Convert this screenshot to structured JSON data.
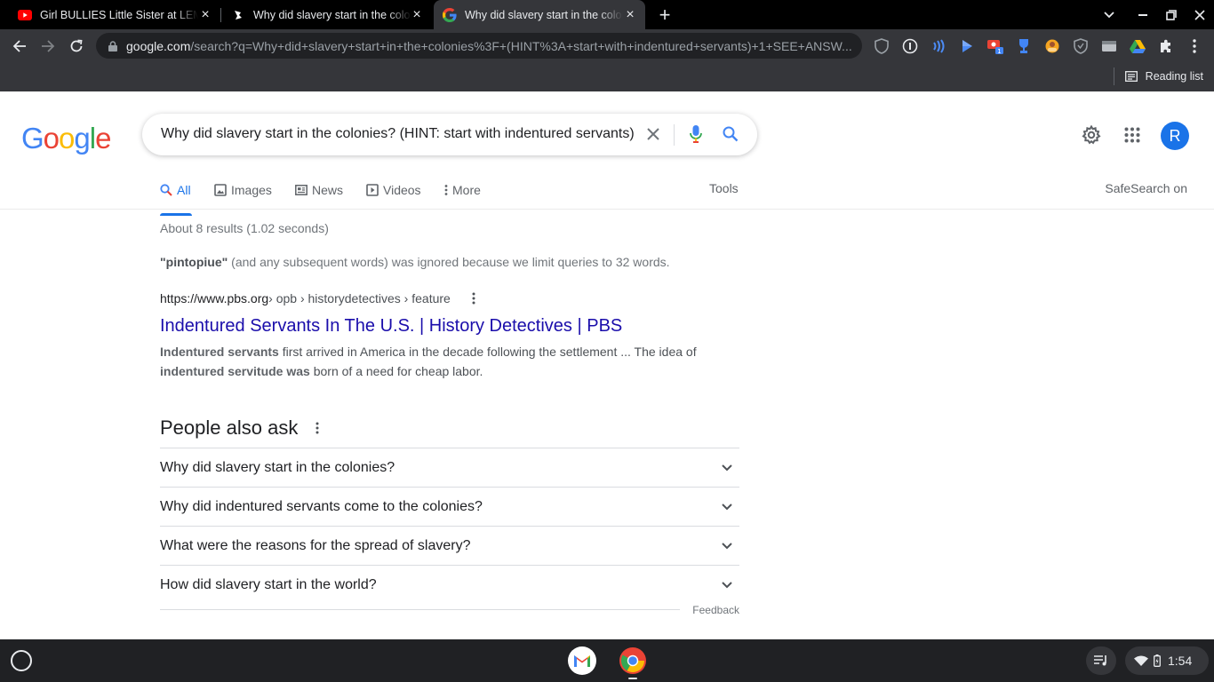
{
  "tabs": [
    {
      "title": "Girl BULLIES Little Sister at LEMONADE STAND",
      "active": false,
      "favicon": "youtube-icon"
    },
    {
      "title": "Why did slavery start in the colonies?",
      "active": false,
      "favicon": "brainly-icon"
    },
    {
      "title": "Why did slavery start in the colonies?",
      "active": true,
      "favicon": "google-icon"
    }
  ],
  "omnibox": {
    "host": "google.com",
    "path": "/search?q=Why+did+slavery+start+in+the+colonies%3F+(HINT%3A+start+with+indentured+servants)+1+SEE+ANSW..."
  },
  "bookmarks": {
    "reading_list": "Reading list"
  },
  "logo": [
    "G",
    "o",
    "o",
    "g",
    "l",
    "e"
  ],
  "colors": {
    "google_blue": "#4285F4",
    "google_red": "#EA4335",
    "google_yellow": "#FBBC05",
    "google_green": "#34A853",
    "link": "#1a0dab",
    "accent": "#1a73e8"
  },
  "search": {
    "query": "Why did slavery start in the colonies? (HINT: start with indentured servants)"
  },
  "user": {
    "initial": "R"
  },
  "nav": {
    "all": "All",
    "images": "Images",
    "news": "News",
    "videos": "Videos",
    "more": "More",
    "tools": "Tools",
    "safesearch": "SafeSearch on"
  },
  "stats": "About 8 results (1.02 seconds)",
  "ignored": {
    "word": "\"pintopiue\"",
    "rest": " (and any subsequent words) was ignored because we limit queries to 32 words."
  },
  "result": {
    "site": "https://www.pbs.org",
    "breadcrumbs": " › opb › historydetectives › feature",
    "title": "Indentured Servants In The U.S. | History Detectives | PBS",
    "snippet": {
      "b1": "Indentured servants",
      "t1": " first arrived in America in the decade following the settlement ... The idea of ",
      "b2": "indentured servitude was",
      "t2": " born of a need for cheap labor."
    }
  },
  "people_also_ask": {
    "heading": "People also ask",
    "questions": [
      "Why did slavery start in the colonies?",
      "Why did indentured servants come to the colonies?",
      "What were the reasons for the spread of slavery?",
      "How did slavery start in the world?"
    ],
    "feedback": "Feedback"
  },
  "shelf": {
    "time": "1:54",
    "apps": [
      "gmail-icon",
      "chrome-icon"
    ]
  }
}
